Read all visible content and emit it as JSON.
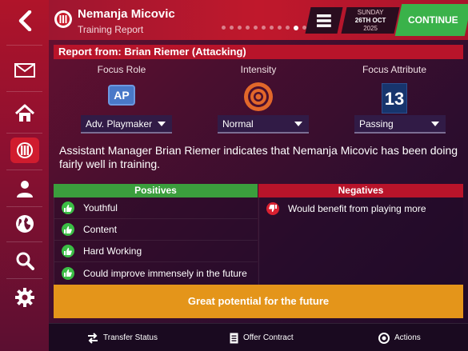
{
  "header": {
    "player_name": "Nemanja Micovic",
    "subtitle": "Training Report",
    "date_day": "SUNDAY",
    "date_main": "26TH OCT",
    "date_year": "2025",
    "continue_label": "CONTINUE",
    "pager": {
      "total": 13,
      "active_index": 9
    }
  },
  "report": {
    "title": "Report from: Brian Riemer (Attacking)",
    "focus_role_label": "Focus Role",
    "focus_role_badge": "AP",
    "focus_role_value": "Adv. Playmaker",
    "intensity_label": "Intensity",
    "intensity_value": "Normal",
    "focus_attribute_label": "Focus Attribute",
    "focus_attribute_badge": "13",
    "focus_attribute_value": "Passing",
    "summary": "Assistant Manager Brian Riemer indicates that Nemanja Micovic has been doing fairly well in training."
  },
  "positives": {
    "heading": "Positives",
    "items": [
      "Youthful",
      "Content",
      "Hard Working",
      "Could improve immensely in the future"
    ]
  },
  "negatives": {
    "heading": "Negatives",
    "items": [
      "Would benefit from playing more"
    ]
  },
  "potential_label": "Great potential for the future",
  "footer": {
    "transfer_status": "Transfer Status",
    "offer_contract": "Offer Contract",
    "actions": "Actions"
  },
  "colors": {
    "accent_red": "#c0182c",
    "continue_green": "#3ab24a",
    "positive_green": "#3b9e3d",
    "potential_orange": "#e4951a",
    "intensity_orange": "#e2672a"
  }
}
